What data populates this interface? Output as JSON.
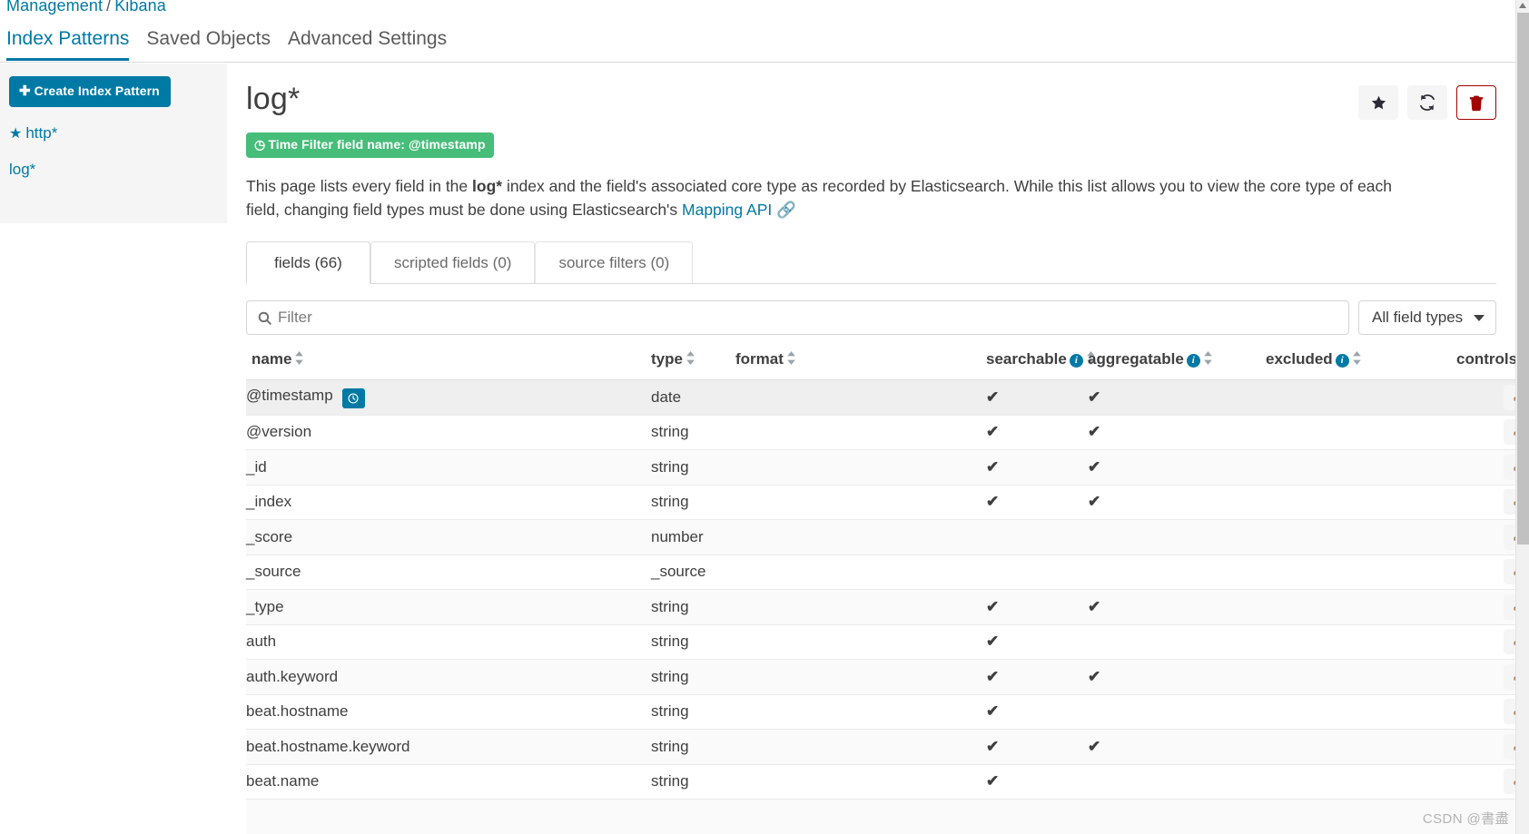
{
  "breadcrumb": {
    "parent": "Management",
    "separator": "/",
    "current": "Kibana"
  },
  "top_tabs": [
    {
      "label": "Index Patterns",
      "active": true
    },
    {
      "label": "Saved Objects",
      "active": false
    },
    {
      "label": "Advanced Settings",
      "active": false
    }
  ],
  "sidebar": {
    "create_button": "Create Index Pattern",
    "create_button_icon": "plus-icon",
    "items": [
      {
        "label": "http*",
        "starred": true,
        "star_icon": "star-icon"
      },
      {
        "label": "log*",
        "starred": false
      }
    ]
  },
  "main": {
    "title": "log*",
    "actions": [
      {
        "name": "set-default-index-button",
        "icon": "star-icon"
      },
      {
        "name": "refresh-fields-button",
        "icon": "refresh-icon"
      },
      {
        "name": "delete-index-pattern-button",
        "icon": "trash-icon"
      }
    ],
    "time_filter_badge": {
      "icon": "clock-icon",
      "text": "Time Filter field name: @timestamp",
      "color": "#46bd79"
    },
    "description": {
      "part1": "This page lists every field in the ",
      "bold1": "log*",
      "part2": " index and the field's associated core type as recorded by Elasticsearch. While this list allows you to view the core type of each field, changing field types must be done using Elasticsearch's ",
      "link": "Mapping API",
      "link_icon": "external-link-icon"
    },
    "tabs": [
      {
        "label": "fields (66)",
        "active": true
      },
      {
        "label": "scripted fields (0)",
        "active": false
      },
      {
        "label": "source filters (0)",
        "active": false
      }
    ],
    "filter": {
      "placeholder": "Filter",
      "value": "",
      "icon": "search-icon"
    },
    "type_select": {
      "selected": "All field types",
      "icon": "chevron-down-icon"
    },
    "table": {
      "columns": [
        {
          "label": "name",
          "sortable": true,
          "info": false
        },
        {
          "label": "type",
          "sortable": true,
          "info": false
        },
        {
          "label": "format",
          "sortable": true,
          "info": false
        },
        {
          "label": "searchable",
          "sortable": true,
          "info": true
        },
        {
          "label": "aggregatable",
          "sortable": true,
          "info": true
        },
        {
          "label": "excluded",
          "sortable": true,
          "info": true
        },
        {
          "label": "controls",
          "sortable": false,
          "info": false
        }
      ],
      "rows": [
        {
          "name": "@timestamp",
          "time_chip": true,
          "type": "date",
          "format": "",
          "searchable": true,
          "aggregatable": true,
          "excluded": false,
          "control_icon": "pencil-icon"
        },
        {
          "name": "@version",
          "time_chip": false,
          "type": "string",
          "format": "",
          "searchable": true,
          "aggregatable": true,
          "excluded": false,
          "control_icon": "pencil-icon"
        },
        {
          "name": "_id",
          "time_chip": false,
          "type": "string",
          "format": "",
          "searchable": true,
          "aggregatable": true,
          "excluded": false,
          "control_icon": "pencil-icon"
        },
        {
          "name": "_index",
          "time_chip": false,
          "type": "string",
          "format": "",
          "searchable": true,
          "aggregatable": true,
          "excluded": false,
          "control_icon": "pencil-icon"
        },
        {
          "name": "_score",
          "time_chip": false,
          "type": "number",
          "format": "",
          "searchable": false,
          "aggregatable": false,
          "excluded": false,
          "control_icon": "pencil-icon"
        },
        {
          "name": "_source",
          "time_chip": false,
          "type": "_source",
          "format": "",
          "searchable": false,
          "aggregatable": false,
          "excluded": false,
          "control_icon": "pencil-icon"
        },
        {
          "name": "_type",
          "time_chip": false,
          "type": "string",
          "format": "",
          "searchable": true,
          "aggregatable": true,
          "excluded": false,
          "control_icon": "pencil-icon"
        },
        {
          "name": "auth",
          "time_chip": false,
          "type": "string",
          "format": "",
          "searchable": true,
          "aggregatable": false,
          "excluded": false,
          "control_icon": "pencil-icon"
        },
        {
          "name": "auth.keyword",
          "time_chip": false,
          "type": "string",
          "format": "",
          "searchable": true,
          "aggregatable": true,
          "excluded": false,
          "control_icon": "pencil-icon"
        },
        {
          "name": "beat.hostname",
          "time_chip": false,
          "type": "string",
          "format": "",
          "searchable": true,
          "aggregatable": false,
          "excluded": false,
          "control_icon": "pencil-icon"
        },
        {
          "name": "beat.hostname.keyword",
          "time_chip": false,
          "type": "string",
          "format": "",
          "searchable": true,
          "aggregatable": true,
          "excluded": false,
          "control_icon": "pencil-icon"
        },
        {
          "name": "beat.name",
          "time_chip": false,
          "type": "string",
          "format": "",
          "searchable": true,
          "aggregatable": false,
          "excluded": false,
          "control_icon": "pencil-icon"
        }
      ]
    }
  },
  "watermark": "CSDN @書盡",
  "colors": {
    "accent": "#0079a5",
    "success": "#46bd79",
    "danger": "#a30000",
    "sidebar_bg": "#f5f5f5"
  }
}
